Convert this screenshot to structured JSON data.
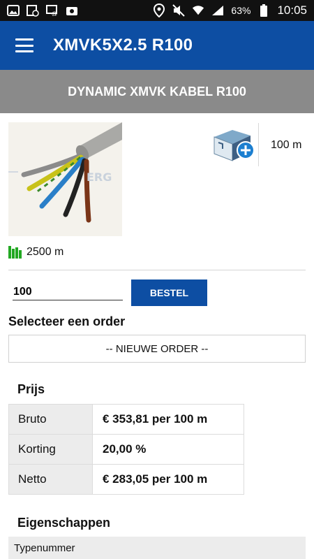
{
  "status_bar": {
    "battery": "63%",
    "time": "10:05"
  },
  "app_bar": {
    "title": "XMVK5X2.5 R100"
  },
  "product": {
    "name": "DYNAMIC XMVK KABEL R100",
    "image_watermark": "ERG",
    "unit": "100 m",
    "stock": "2500 m"
  },
  "order": {
    "quantity": "100",
    "order_button": "BESTEL",
    "select_label": "Selecteer een order",
    "selected_order": "-- NIEUWE ORDER --"
  },
  "price": {
    "title": "Prijs",
    "rows": [
      {
        "label": "Bruto",
        "value": "€ 353,81 per 100 m"
      },
      {
        "label": "Korting",
        "value": "20,00 %"
      },
      {
        "label": "Netto",
        "value": "€ 283,05 per 100 m"
      }
    ]
  },
  "properties": {
    "title": "Eigenschappen",
    "first_row_label": "Typenummer"
  },
  "colors": {
    "brand_blue": "#0d4ea3",
    "header_gray": "#8a8a8a",
    "stock_green": "#22a822"
  },
  "icons": [
    "image-icon",
    "calendar-icon",
    "voicemail-icon",
    "photo-icon",
    "location-icon",
    "mute-icon",
    "wifi-icon",
    "signal-icon",
    "battery-icon",
    "menu-icon",
    "add-box-icon",
    "stock-icon"
  ]
}
